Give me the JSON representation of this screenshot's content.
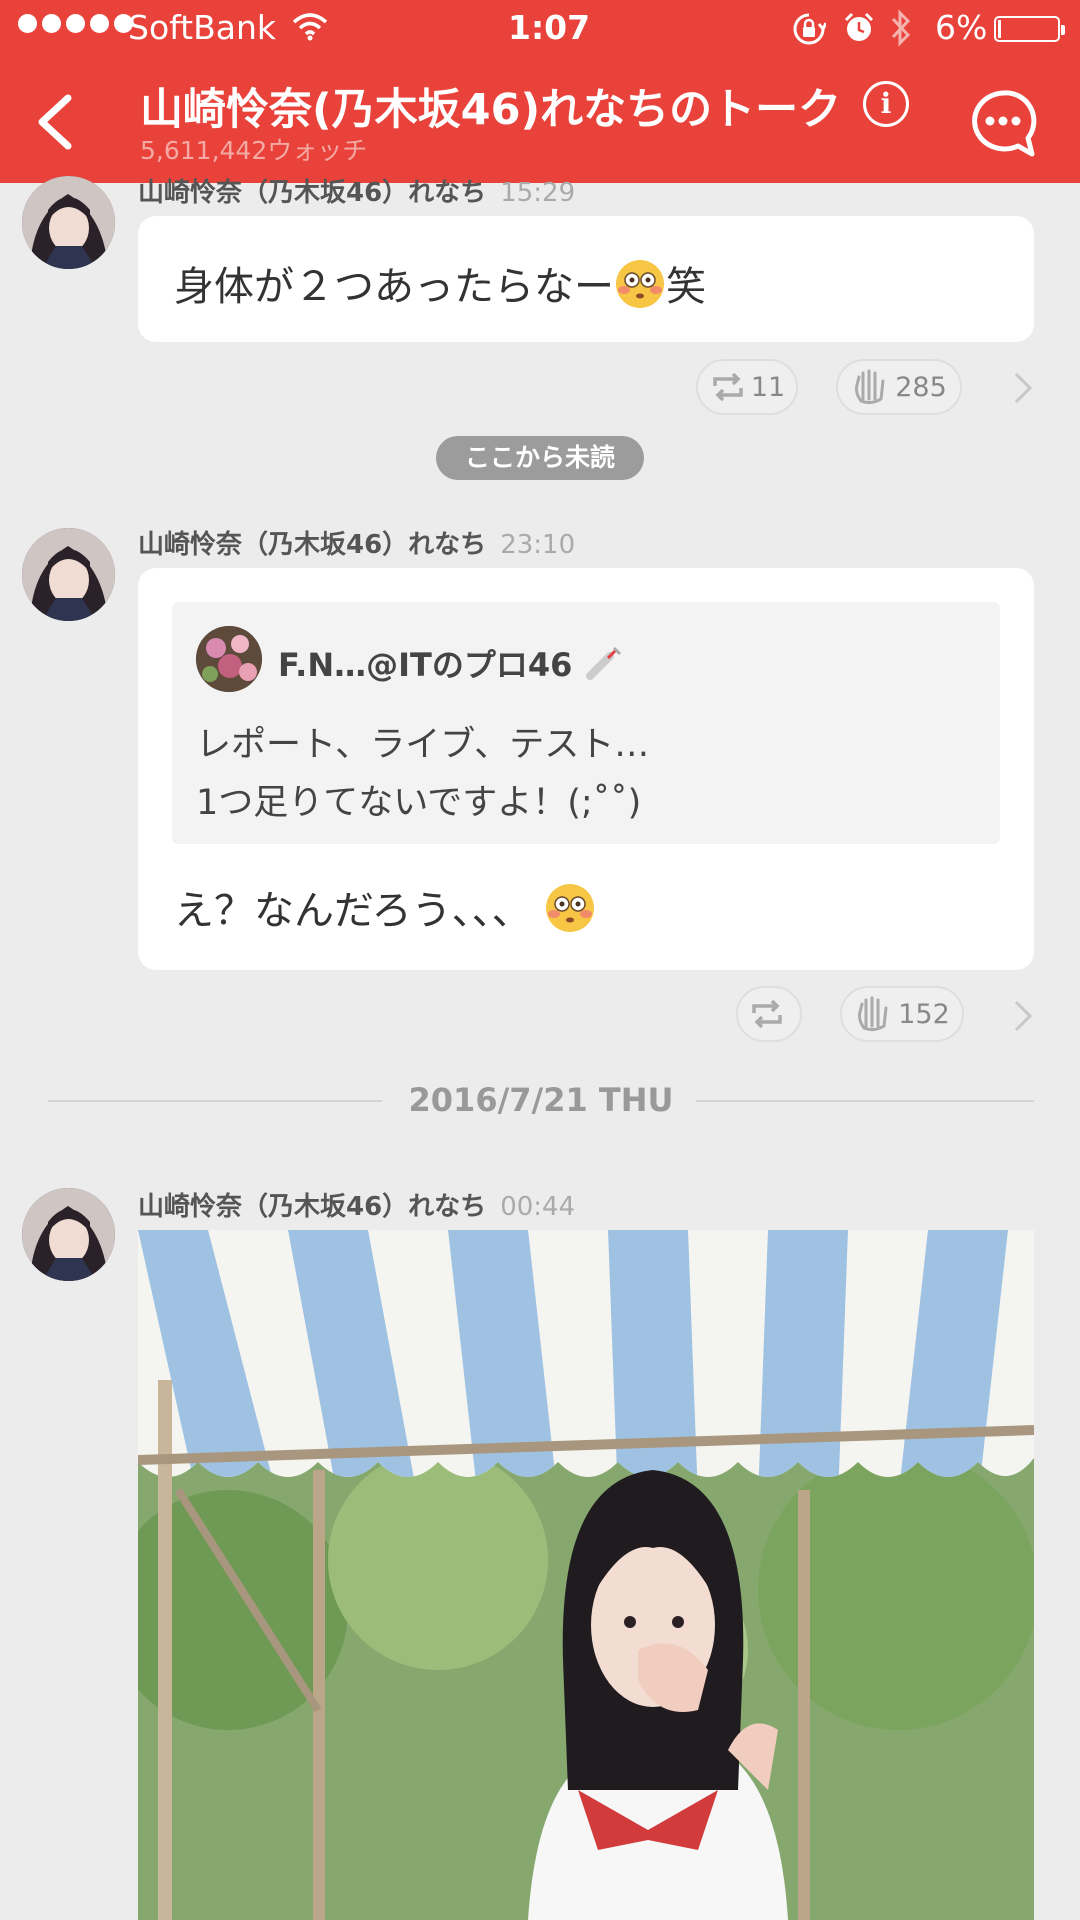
{
  "status_bar": {
    "carrier": "SoftBank",
    "time": "1:07",
    "battery_text": "6%",
    "battery_level": 0.06,
    "icons": [
      "signal-dots-icon",
      "wifi-icon",
      "rotation-lock-icon",
      "alarm-icon",
      "bluetooth-icon",
      "battery-icon"
    ]
  },
  "header": {
    "title": "山崎怜奈(乃木坂46)れなちのトーク",
    "watch_count": "5,611,442ウォッチ",
    "icons": [
      "back-arrow-icon",
      "info-icon",
      "chat-bubble-icon"
    ]
  },
  "colors": {
    "brand": "#e8423a",
    "background": "#ececec",
    "bubble": "#ffffff",
    "unread_badge": "#9c9c9c"
  },
  "messages": [
    {
      "author": "山崎怜奈（乃木坂46）れなち",
      "time": "15:29",
      "text_before_emoji": "身体が２つあったらなー",
      "emoji": "flushed-face-emoji",
      "text_after_emoji": "笑",
      "retweet_count": "11",
      "clap_count": "285"
    },
    {
      "author": "山崎怜奈（乃木坂46）れなち",
      "time": "23:10",
      "quote": {
        "user": "F.N…@ITのプロ46",
        "user_emoji": "syringe-icon",
        "lines": [
          "レポート、ライブ、テスト…",
          "1つ足りてないですよ！(;˚˚)"
        ]
      },
      "text": "え？なんだろう、、、",
      "emoji": "flushed-face-emoji",
      "retweet_count": "",
      "clap_count": "152"
    },
    {
      "author": "山崎怜奈（乃木坂46）れなち",
      "time": "00:44",
      "photo": "girl-under-striped-tent-photo"
    }
  ],
  "unread_marker": "ここから未読",
  "date_separator": "2016/7/21 THU"
}
